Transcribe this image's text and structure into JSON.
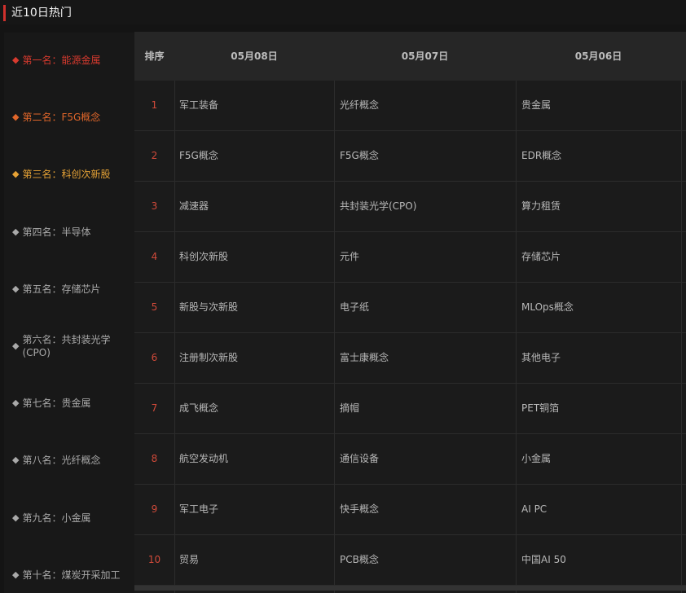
{
  "header": {
    "title": "近10日热门"
  },
  "ranking": [
    {
      "label": "第一名：能源金属",
      "tier": "c1"
    },
    {
      "label": "第二名：F5G概念",
      "tier": "c2"
    },
    {
      "label": "第三名：科创次新股",
      "tier": "c3"
    },
    {
      "label": "第四名：半导体",
      "tier": "cn"
    },
    {
      "label": "第五名：存储芯片",
      "tier": "cn"
    },
    {
      "label": "第六名：共封装光学\n(CPO)",
      "tier": "cn"
    },
    {
      "label": "第七名：贵金属",
      "tier": "cn"
    },
    {
      "label": "第八名：光纤概念",
      "tier": "cn"
    },
    {
      "label": "第九名：小金属",
      "tier": "cn"
    },
    {
      "label": "第十名：煤炭开采加工",
      "tier": "cn"
    }
  ],
  "table": {
    "headers": [
      "排序",
      "05月08日",
      "05月07日",
      "05月06日"
    ],
    "rows": [
      {
        "rank": "1",
        "d1": "军工装备",
        "d2": "光纤概念",
        "d3": "贵金属"
      },
      {
        "rank": "2",
        "d1": "F5G概念",
        "d2": "F5G概念",
        "d3": "EDR概念"
      },
      {
        "rank": "3",
        "d1": "减速器",
        "d2": "共封装光学(CPO)",
        "d3": "算力租赁"
      },
      {
        "rank": "4",
        "d1": "科创次新股",
        "d2": "元件",
        "d3": "存储芯片"
      },
      {
        "rank": "5",
        "d1": "新股与次新股",
        "d2": "电子纸",
        "d3": "MLOps概念"
      },
      {
        "rank": "6",
        "d1": "注册制次新股",
        "d2": "富士康概念",
        "d3": "其他电子"
      },
      {
        "rank": "7",
        "d1": "成飞概念",
        "d2": "摘帽",
        "d3": "PET铜箔"
      },
      {
        "rank": "8",
        "d1": "航空发动机",
        "d2": "通信设备",
        "d3": "小金属"
      },
      {
        "rank": "9",
        "d1": "军工电子",
        "d2": "快手概念",
        "d3": "AI PC"
      },
      {
        "rank": "10",
        "d1": "贸易",
        "d2": "PCB概念",
        "d3": "中国AI 50"
      }
    ]
  },
  "colors": {
    "accent": "#d0312d",
    "rank1": "#d73a2e",
    "rank2": "#e0662a",
    "rank3": "#e6a235",
    "rank_other": "#a9a9a9",
    "rank_number": "#d14a3a"
  }
}
